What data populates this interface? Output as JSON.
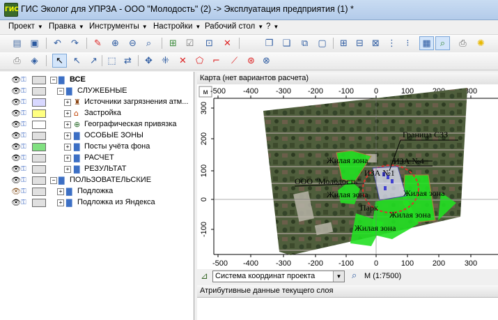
{
  "window": {
    "title": "ГИС Эколог для УПРЗА - ООО \"Молодость\" (2) -> Эксплуатация предприятия (1) *",
    "icon": "gis-app-icon"
  },
  "menu": [
    {
      "label": "Проект"
    },
    {
      "label": "Правка"
    },
    {
      "label": "Инструменты"
    },
    {
      "label": "Настройки"
    },
    {
      "label": "Рабочий стол"
    },
    {
      "label": "?"
    }
  ],
  "layers": {
    "root": {
      "label": "ВСЕ"
    },
    "items": [
      {
        "label": "СЛУЖЕБНЫЕ",
        "level": 1,
        "swatch": "#e0e0e0"
      },
      {
        "label": "Источники загрязнения атм...",
        "level": 2,
        "swatch": "#d8d8ff",
        "icon": "chimney-icon"
      },
      {
        "label": "Застройка",
        "level": 2,
        "swatch": "#ffff80",
        "icon": "building-icon"
      },
      {
        "label": "Географическая привязка",
        "level": 2,
        "swatch": "#ffffff",
        "icon": "globe-icon"
      },
      {
        "label": "ОСОБЫЕ ЗОНЫ",
        "level": 1,
        "swatch": "#e0e0e0"
      },
      {
        "label": "Посты учёта фона",
        "level": 1,
        "swatch": "#80e080"
      },
      {
        "label": "РАСЧЕТ",
        "level": 1,
        "swatch": "#e0e0e0"
      },
      {
        "label": "РЕЗУЛЬТАТ",
        "level": 1,
        "swatch": "#e0e0e0"
      },
      {
        "label": "ПОЛЬЗОВАТЕЛЬСКИЕ",
        "level": 0,
        "swatch": "#e0e0e0"
      },
      {
        "label": "Подложка",
        "level": 1,
        "swatch": "#e0e0e0"
      },
      {
        "label": "Подложка из Яндекса",
        "level": 1,
        "swatch": "#e0e0e0"
      }
    ]
  },
  "map": {
    "header": "Карта (нет вариантов расчета)",
    "unit_label": "м",
    "x_ticks": [
      "-500",
      "-400",
      "-300",
      "-200",
      "-100",
      "0",
      "100",
      "200",
      "300"
    ],
    "y_ticks": [
      "300",
      "200",
      "100",
      "0",
      "-100"
    ],
    "labels": [
      {
        "text": "Граница СЗЗ"
      },
      {
        "text": "Жилая зона"
      },
      {
        "text": "ИЗА №4"
      },
      {
        "text": "ИЗА №1"
      },
      {
        "text": "ООО \"Молодость\""
      },
      {
        "text": "Жилая зона"
      },
      {
        "text": "Жилая зона"
      },
      {
        "text": "Парк"
      },
      {
        "text": "Жилая зона"
      },
      {
        "text": "Жилая зона"
      }
    ]
  },
  "coord_system": {
    "value": "Система координат проекта"
  },
  "scale": {
    "label": "М (1:7500)"
  },
  "attr_panel": {
    "header": "Атрибутивные данные текущего слоя"
  }
}
